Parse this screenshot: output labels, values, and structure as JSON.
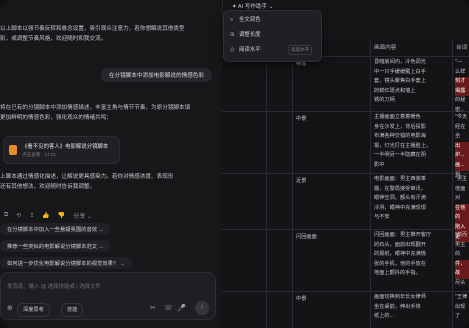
{
  "topbar": {
    "assistant_label": "✦ AI 写作助手 ⌄"
  },
  "menu": {
    "items": [
      {
        "icon": "≡",
        "label": "全文润色"
      },
      {
        "icon": "⊞",
        "label": "调整长度"
      },
      {
        "icon": "◎",
        "label": "阅读水平",
        "badge": "高级水平"
      }
    ]
  },
  "chat": {
    "para1_line1": "以上脚本以强节奏反转和悬念设置，吸引观众注意力，若你想解说其他类型",
    "para1_line2": "影，或调整节奏风格，欢迎随时和我交流。",
    "user_message": "在分镜脚本中添加电影解说的情感色彩",
    "para2_line1": "将在已有的分镜脚本中添加情感描述，丰富主角与情节节奏，为原分镜脚本填",
    "para2_line2": "更加鲜明的情感色彩，强化观众的情绪共鸣：",
    "doc_title": "《看不见的客人》电影解说分镜脚本",
    "doc_sub": "点击查看 · 17:21",
    "para3_line1": "上脚本通过情感化描述，让解说更具感染力。若你对情感浓度、表现形",
    "para3_line2": "还有其他想法，欢迎随时告诉我调整。",
    "actions": [
      "⧉",
      "⟲",
      "↥",
      "👍",
      "👎",
      "分享 ⌄"
    ],
    "suggestions": [
      "在分镜脚本中加入一些悬疑氛围的音效 →",
      "推荐一些类似的电影解说分镜脚本范文 →",
      "如何进一步优化电影解说分镜脚本的视觉效果？ →"
    ],
    "input_placeholder": "发消息、输入 @ 选择技能或 / 选择文件",
    "tools": {
      "deep_think": "深度思考",
      "skills": "技能"
    },
    "icons": {
      "scissors": "✂",
      "phone": "☏",
      "mic": "🎤",
      "send": "↑"
    }
  },
  "table": {
    "headers": [
      "",
      "",
      "画面内容",
      "台词"
    ],
    "rows": [
      {
        "c1": "",
        "c2": "特写",
        "content": [
          "昏暗房间内，冷色调光",
          "中一只手缓缓戴上白手",
          "套，镜头聚焦白手套上",
          "的鲜红斑点和墙上",
          "锈的刀柄"
        ],
        "line": [
          "\"—",
          "么样",
          "刻才揭露",
          "的秘密..."
        ]
      },
      {
        "c1": "",
        "c2": "中景",
        "content": [
          "主播画面立着着暖色",
          "身在沙发上，背后投影",
          "布满各种交错的电影海",
          "报，灯光打在主播脸上，",
          "一半明另一半隐藏在阴",
          "影中"
        ],
        "line": [
          "\"今天",
          "经在全",
          "出炉...",
          "画...",
          "相..."
        ]
      },
      {
        "c1": "",
        "c2": "近景",
        "content": [
          "电影画面：男主西装革",
          "履，在警局接受审讯，",
          "眼神空洞，额头有汗滴",
          "冷冽，眼神中充满恐惧",
          "与不安"
        ],
        "line": [
          "\"男主",
          "他面对",
          "在他的",
          "陷入更"
        ]
      },
      {
        "c1": "",
        "c2": "闪回画面",
        "content": [
          "闪回画面：男主推开客厅",
          "的石头，面前出现翻开",
          "的报纸，眼神中充满慌",
          "张的手机，他的手放在",
          "地面上颤抖的手指，"
        ],
        "line": [
          "\"然而",
          "男主的",
          "件，故",
          "尽头"
        ]
      },
      {
        "c1": "",
        "c2": "中景",
        "content": [
          "画面切换到年长女律师",
          "坐在桌前，伸出手将",
          "纸上的...",
          "桌前..."
        ],
        "line": [
          "\"王律",
          "出现了"
        ]
      }
    ]
  }
}
